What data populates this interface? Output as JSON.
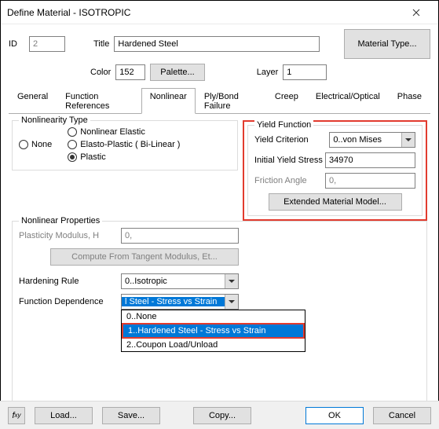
{
  "window": {
    "title": "Define Material - ISOTROPIC"
  },
  "header": {
    "id_label": "ID",
    "id_value": "2",
    "title_label": "Title",
    "title_value": "Hardened Steel",
    "color_label": "Color",
    "color_value": "152",
    "palette": "Palette...",
    "layer_label": "Layer",
    "layer_value": "1",
    "mattype": "Material Type..."
  },
  "tabs": [
    "General",
    "Function References",
    "Nonlinear",
    "Ply/Bond Failure",
    "Creep",
    "Electrical/Optical",
    "Phase"
  ],
  "active_tab": "Nonlinear",
  "nonlin_type": {
    "legend": "Nonlinearity Type",
    "none": "None",
    "ne": "Nonlinear Elastic",
    "ep": "Elasto-Plastic ( Bi-Linear )",
    "pl": "Plastic"
  },
  "yield": {
    "legend": "Yield Function",
    "crit_label": "Yield Criterion",
    "crit_value": "0..von Mises",
    "iys_label": "Initial Yield Stress",
    "iys_value": "34970",
    "fa_label": "Friction Angle",
    "fa_value": "0,",
    "ext": "Extended Material Model..."
  },
  "props": {
    "legend": "Nonlinear Properties",
    "pm_label": "Plasticity Modulus, H",
    "pm_value": "0,",
    "compute": "Compute From Tangent Modulus, Et...",
    "hr_label": "Hardening Rule",
    "hr_value": "0..Isotropic",
    "fd_label": "Function Dependence",
    "fd_value": "l Steel - Stress vs Strain",
    "fd_options": [
      "0..None",
      "1..Hardened Steel - Stress vs Strain",
      "2..Coupon Load/Unload"
    ]
  },
  "footer": {
    "load": "Load...",
    "save": "Save...",
    "copy": "Copy...",
    "ok": "OK",
    "cancel": "Cancel"
  }
}
